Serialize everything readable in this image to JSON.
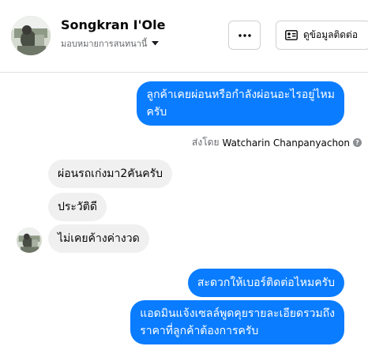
{
  "header": {
    "name": "Songkran I'Ole",
    "assignee": "มอบหมายการสนทนานี้",
    "more_label": "···",
    "contact_label": "ดูข้อมูลติดต่อ"
  },
  "messages": [
    {
      "dir": "out",
      "lines": [
        "ลูกค้าเคยผ่อนหรือกำลังผ่อนอะไรอยู่ไหม",
        "ครับ"
      ]
    },
    {
      "dir": "in",
      "text": "ผ่อนรถเก่งมา2คันครับ"
    },
    {
      "dir": "in",
      "text": "ประวัติดี"
    },
    {
      "dir": "in",
      "text": "ไม่เคยค้างค่างวด"
    },
    {
      "dir": "out",
      "text": "สะดวกให้เบอร์ติดต่อไหมครับ"
    },
    {
      "dir": "out",
      "lines": [
        "แอดมินแจ้งเซลล์พูดคุยรายละเอียดรวมถึง",
        "ราคาที่ลูกค้าต้องการครับ"
      ]
    }
  ],
  "sent_by": {
    "prefix": "ส่งโดย",
    "agent": "Watcharin Chanpanyachon",
    "icon": "info-icon"
  },
  "colors": {
    "outgoing": "#0a7cff",
    "incoming": "#f0f0f0",
    "secondary_text": "#65676b"
  }
}
